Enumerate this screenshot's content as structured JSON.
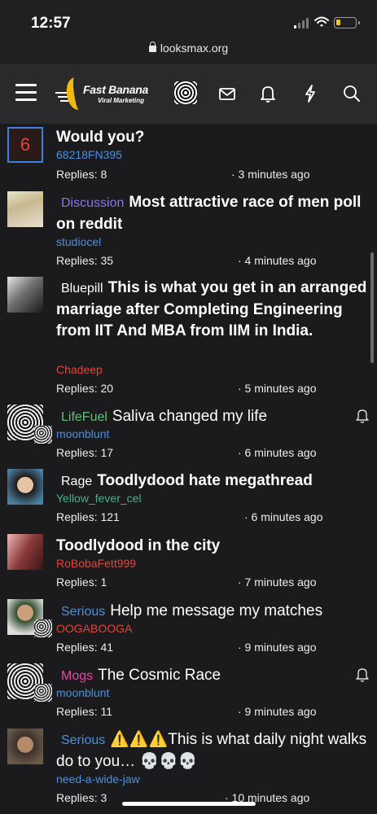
{
  "status_bar": {
    "time": "12:57"
  },
  "browser": {
    "url": "looksmax.org"
  },
  "header": {
    "logo_title": "Fast Banana",
    "logo_subtitle": "Viral Marketing",
    "icons": [
      "menu-icon",
      "avatar-swirl-icon",
      "mail-icon",
      "bell-icon",
      "lightning-icon",
      "search-icon"
    ]
  },
  "colors": {
    "background": "#1b1b1d",
    "header": "#2a2a2c",
    "author_blue": "#4a90e2",
    "author_red": "#e0463a",
    "author_green": "#4fae8a",
    "prefix_discussion": "#8f74e6",
    "prefix_lifefuel": "#5fc07a",
    "prefix_serious": "#4a90e2",
    "prefix_mogs": "#e04aa0"
  },
  "threads": [
    {
      "prefix": "",
      "title": "Would you?",
      "author": "68218FN395",
      "replies": "Replies: 8",
      "time": "· 3 minutes ago"
    },
    {
      "prefix": "Discussion",
      "title": "Most attractive race of men poll on reddit",
      "author": "studiocel",
      "replies": "Replies: 35",
      "time": "· 4 minutes ago"
    },
    {
      "prefix": "Bluepill",
      "title": "This is what you get in an arranged marriage after Completing Engineering from IIT And MBA from IIM in India.",
      "author": "Chadeep",
      "replies": "Replies: 20",
      "time": "· 5 minutes ago"
    },
    {
      "prefix": "LifeFuel",
      "title": "Saliva changed my life",
      "author": "moonblunt",
      "replies": "Replies: 17",
      "time": "· 6 minutes ago"
    },
    {
      "prefix": "Rage",
      "title": "Toodlydood hate megathread",
      "author": "Yellow_fever_cel",
      "replies": "Replies: 121",
      "time": "· 6 minutes ago"
    },
    {
      "prefix": "",
      "title": "Toodlydood in the city",
      "author": "RoBobaFett999",
      "replies": "Replies: 1",
      "time": "· 7 minutes ago"
    },
    {
      "prefix": "Serious",
      "title": "Help me message my matches",
      "author": "OOGABOOGA",
      "replies": "Replies: 41",
      "time": "· 9 minutes ago"
    },
    {
      "prefix": "Mogs",
      "title": "The Cosmic Race",
      "author": "moonblunt",
      "replies": "Replies: 11",
      "time": "· 9 minutes ago"
    },
    {
      "prefix": "Serious",
      "title": "⚠️⚠️⚠️This is what daily night walks do to you… 💀💀💀",
      "author": "need-a-wide-jaw",
      "replies": "Replies: 3",
      "time": "· 10 minutes ago"
    }
  ],
  "avatars": {
    "thread_0_letter": "6"
  }
}
